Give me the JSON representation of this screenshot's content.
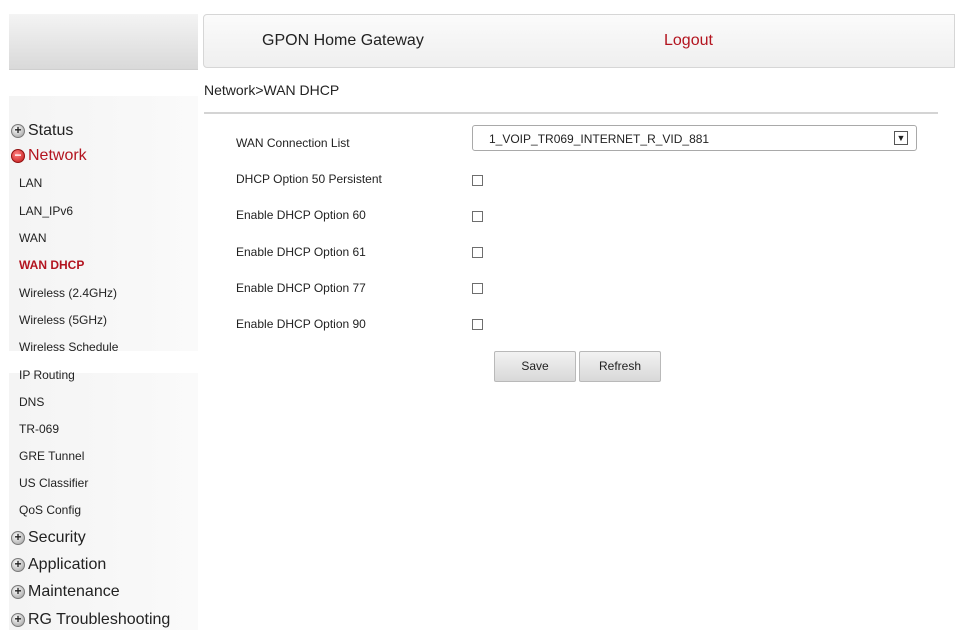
{
  "header": {
    "title": "GPON Home Gateway",
    "logout_label": "Logout"
  },
  "breadcrumb": "Network>WAN DHCP",
  "sidebar": {
    "sections": {
      "status": "Status",
      "network": "Network",
      "security": "Security",
      "application": "Application",
      "maintenance": "Maintenance",
      "troubleshooting": "RG Troubleshooting"
    },
    "network_items": [
      "LAN",
      "LAN_IPv6",
      "WAN",
      "WAN DHCP",
      "Wireless (2.4GHz)",
      "Wireless (5GHz)",
      "Wireless Schedule",
      "IP Routing",
      "DNS",
      "TR-069",
      "GRE Tunnel",
      "US Classifier",
      "QoS Config"
    ],
    "active_item": "WAN DHCP"
  },
  "form": {
    "wan_connection_label": "WAN Connection List",
    "wan_connection_value": "1_VOIP_TR069_INTERNET_R_VID_881",
    "options": [
      {
        "label": "DHCP Option 50 Persistent",
        "checked": false
      },
      {
        "label": "Enable DHCP Option 60",
        "checked": false
      },
      {
        "label": "Enable DHCP Option 61",
        "checked": false
      },
      {
        "label": "Enable DHCP Option 77",
        "checked": false
      },
      {
        "label": "Enable DHCP Option 90",
        "checked": false
      }
    ],
    "save_label": "Save",
    "refresh_label": "Refresh"
  },
  "colors": {
    "accent": "#b3141f"
  }
}
